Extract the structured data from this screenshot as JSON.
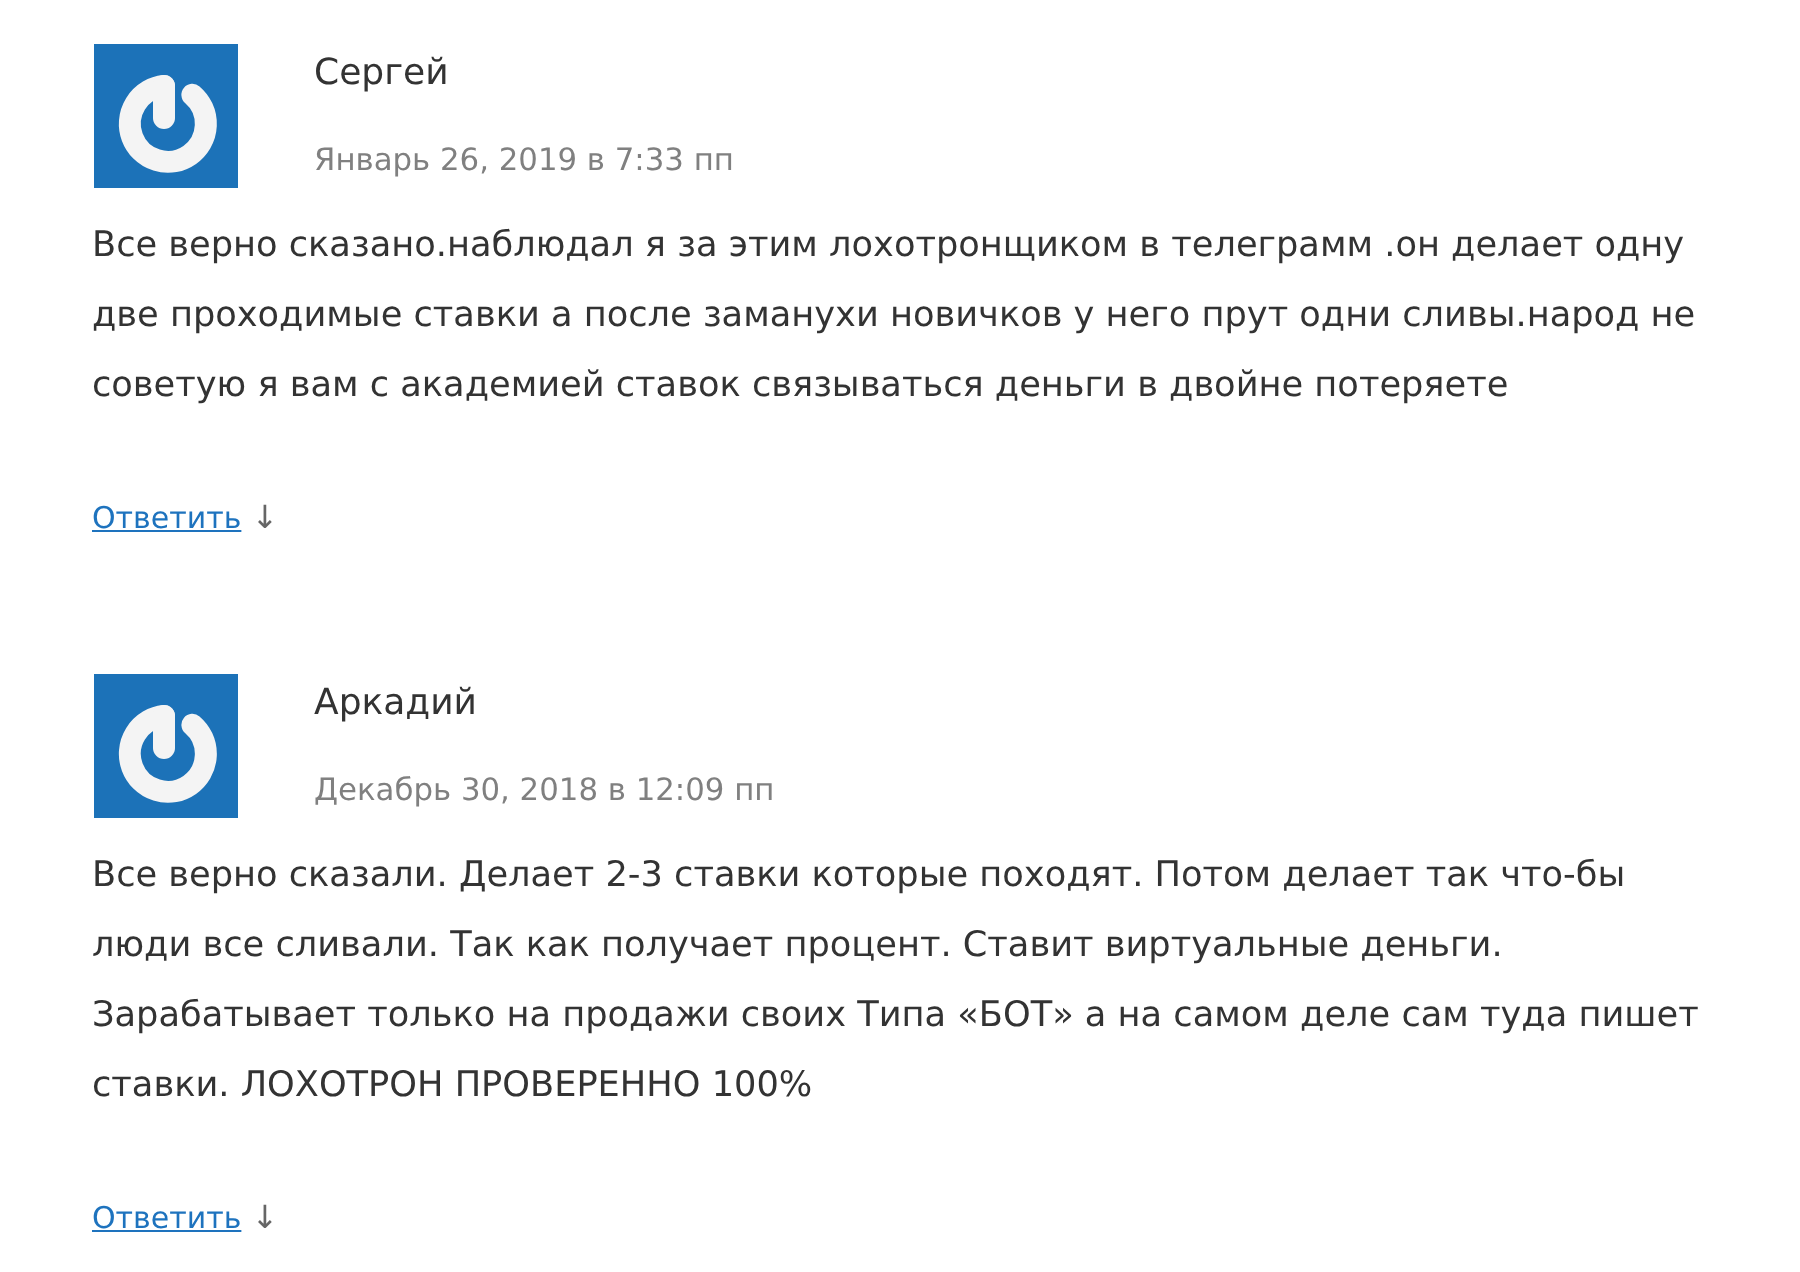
{
  "comments": [
    {
      "author": "Сергей",
      "date": "Январь 26, 2019 в 7:33 пп",
      "text": "Все верно сказано.наблюдал я за этим лохотронщиком в телеграмм .он делает одну две проходимые ставки а после заманухи новичков у него прут одни сливы.народ не советую я вам с академией ставок связываться деньги в двойне потеряете",
      "reply": {
        "label": "Ответить",
        "arrow": "↓"
      }
    },
    {
      "author": "Аркадий",
      "date": "Декабрь 30, 2018 в 12:09 пп",
      "text": "Все верно сказали. Делает 2-3 ставки которые походят. Потом делает так что-бы люди все сливали. Так как получает процент. Ставит виртуальные деньги. Зарабатывает только на продажи своих Типа «БОТ» а на самом деле сам туда пишет ставки. ЛОХОТРОН ПРОВЕРЕННО 100%",
      "reply": {
        "label": "Ответить",
        "arrow": "↓"
      }
    }
  ]
}
